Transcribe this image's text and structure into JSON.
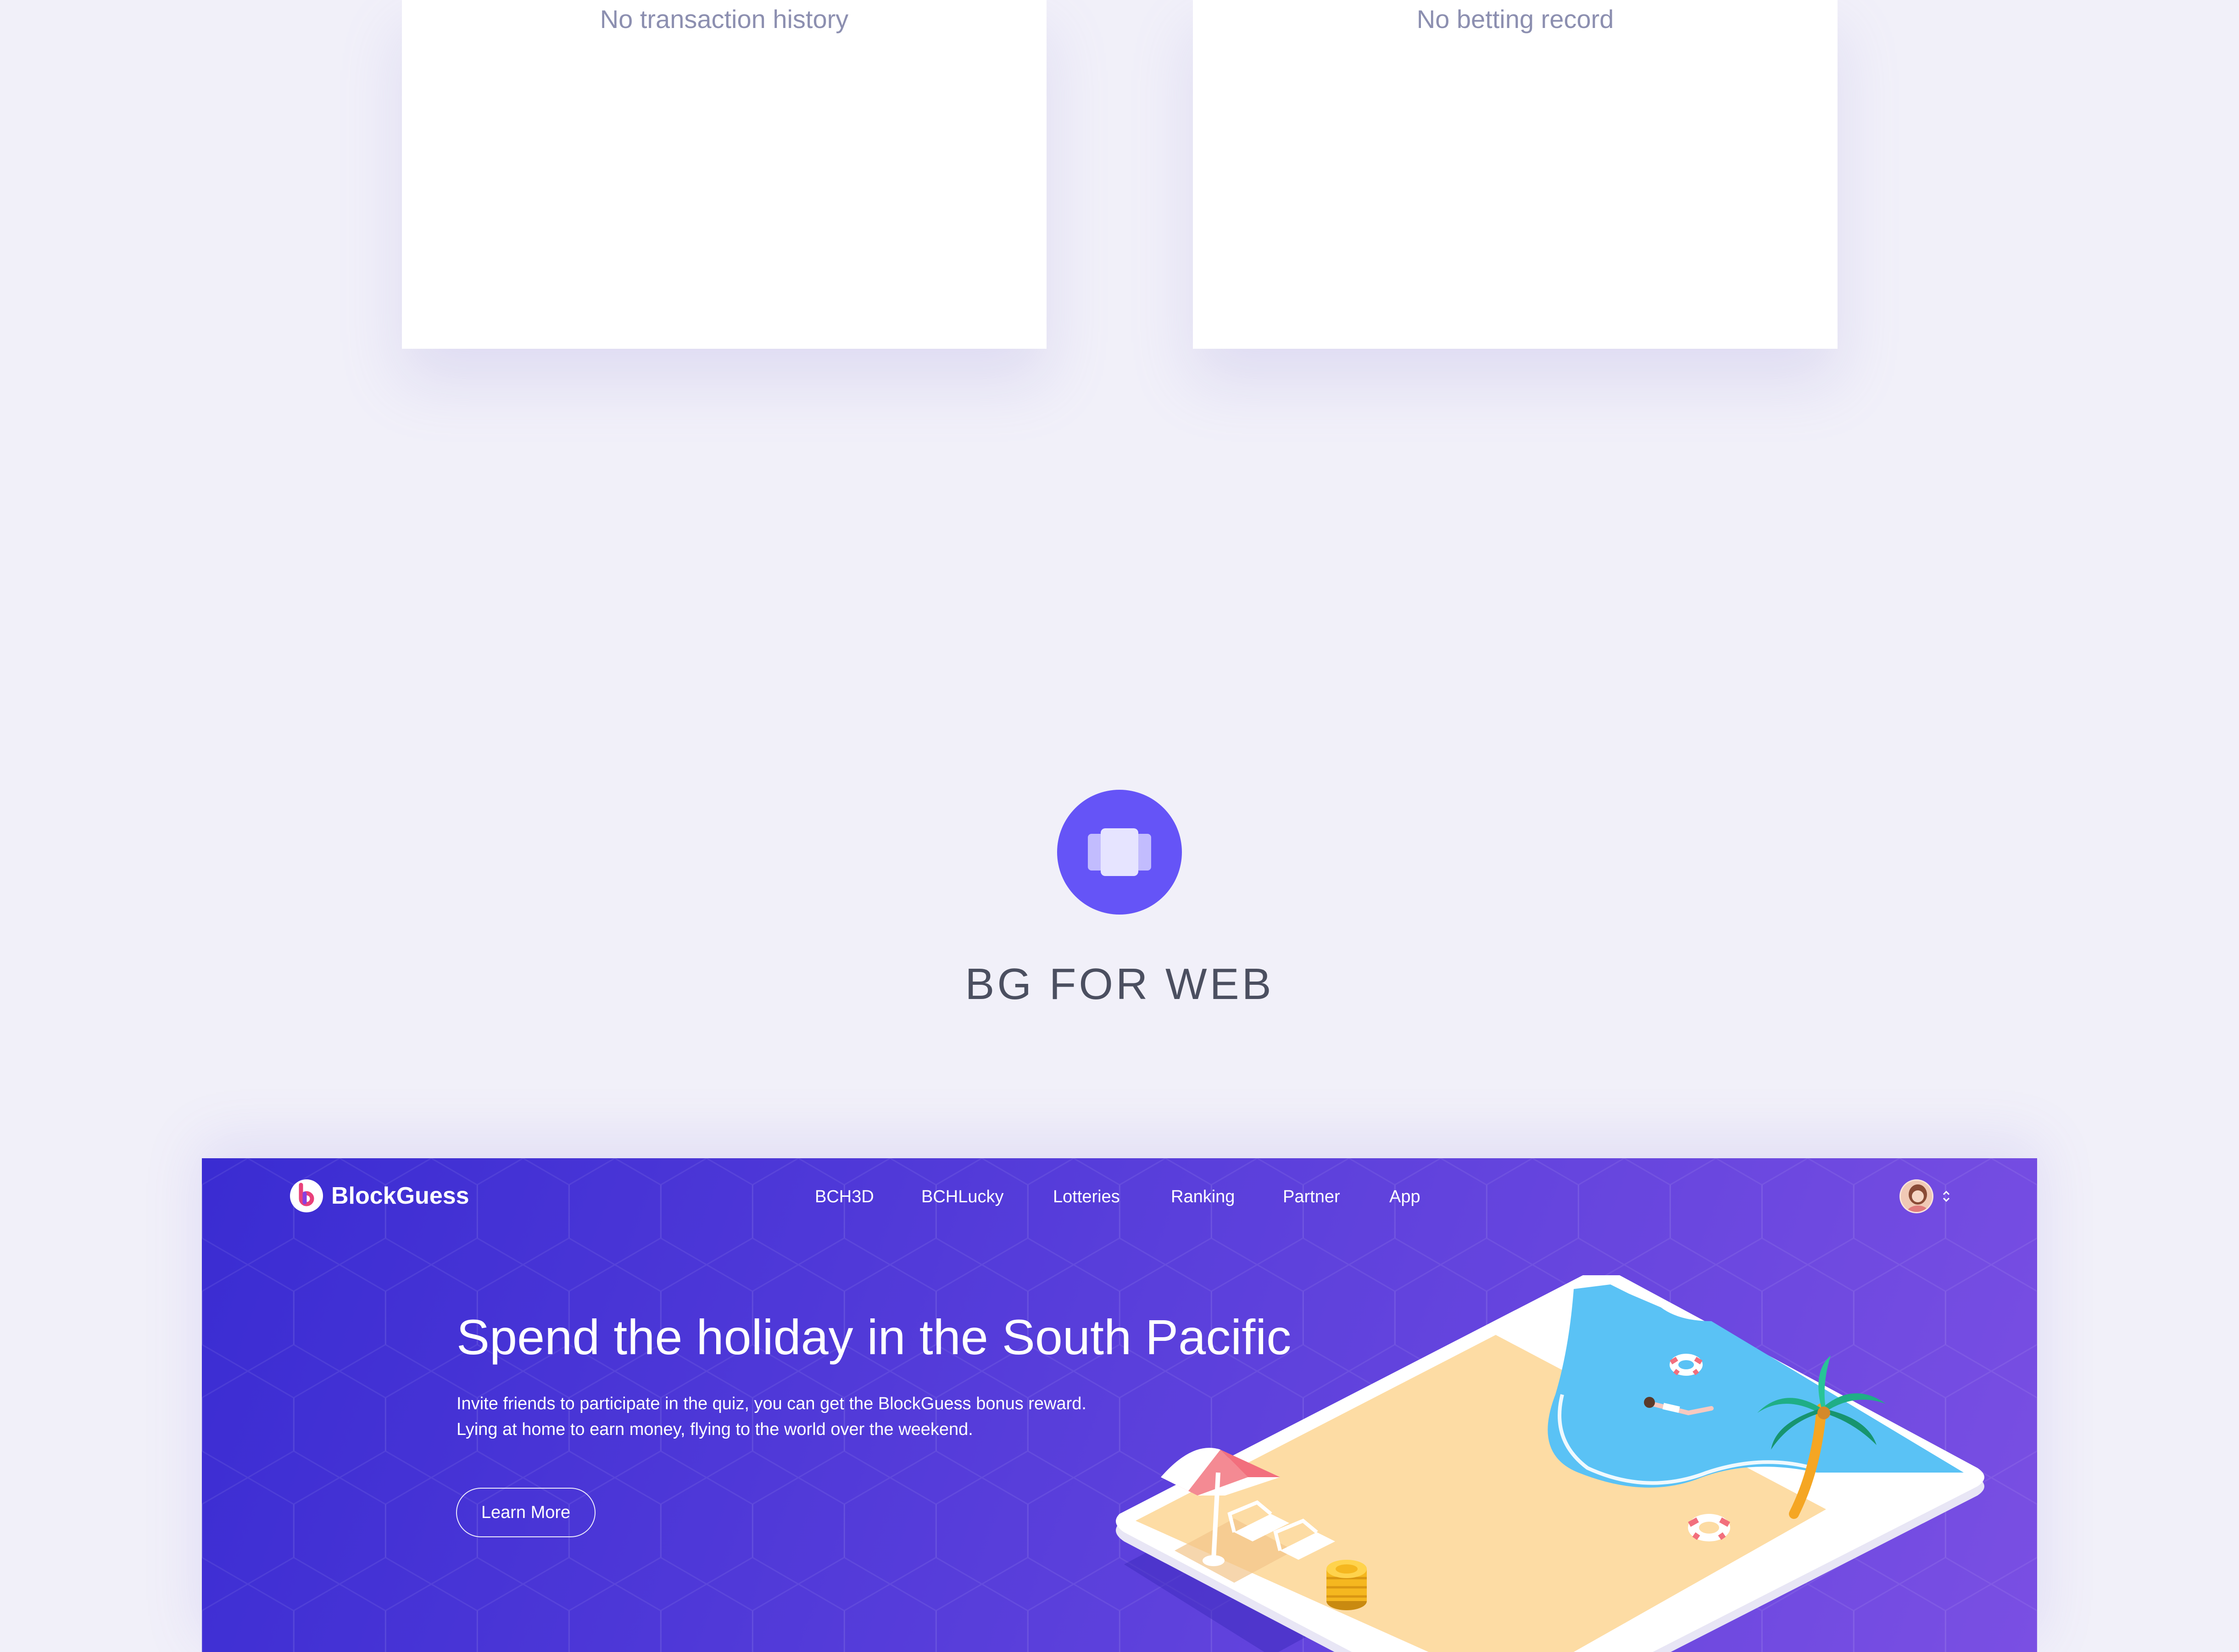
{
  "cards": {
    "transaction_empty": "No transaction history",
    "betting_empty": "No betting record"
  },
  "section": {
    "icon": "web-pages-icon",
    "title": "BG FOR WEB"
  },
  "banner": {
    "brand": "BlockGuess",
    "nav": [
      "BCH3D",
      "BCHLucky",
      "Lotteries",
      "Ranking",
      "Partner",
      "App"
    ],
    "hero_title": "Spend the holiday in the South Pacific",
    "hero_line1": "Invite friends to participate in the quiz, you can get the BlockGuess bonus reward.",
    "hero_line2": "Lying at home to earn money, flying to the world over the weekend.",
    "cta": "Learn More"
  },
  "colors": {
    "page_bg": "#f1f0f9",
    "accent": "#6554f7",
    "banner_start": "#3a2cd2",
    "banner_end": "#7a4fe3"
  }
}
